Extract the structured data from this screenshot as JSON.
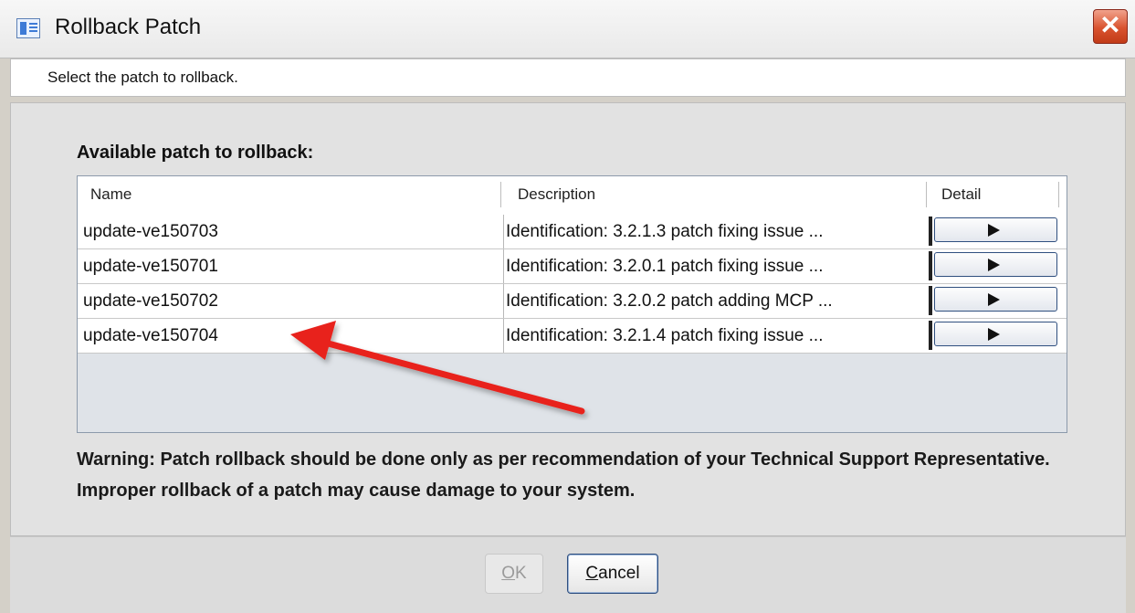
{
  "window": {
    "title": "Rollback Patch",
    "close_glyph": "✕"
  },
  "instruction": "Select the patch to rollback.",
  "list": {
    "label": "Available patch to rollback:",
    "columns": [
      "Name",
      "Description",
      "Detail"
    ],
    "rows": [
      {
        "name": "update-ve150703",
        "description": "Identification: 3.2.1.3 patch fixing issue ..."
      },
      {
        "name": "update-ve150701",
        "description": "Identification: 3.2.0.1 patch fixing issue ..."
      },
      {
        "name": "update-ve150702",
        "description": "Identification: 3.2.0.2 patch adding MCP ..."
      },
      {
        "name": "update-ve150704",
        "description": "Identification: 3.2.1.4 patch fixing issue ..."
      }
    ]
  },
  "warning": "Warning: Patch rollback should be done only as per recommendation of your Technical Support Representative. Improper rollback of a patch may cause damage to your system.",
  "buttons": {
    "ok_mnemonic": "O",
    "ok_rest": "K",
    "cancel_mnemonic": "C",
    "cancel_rest": "ancel"
  },
  "icons": {
    "title": "app-window-icon",
    "close": "close-icon",
    "detail": "play-arrow-icon",
    "annotation": "red-arrow-annotation"
  },
  "colors": {
    "close_button": "#d9532f",
    "annotation_arrow": "#e8231c",
    "disabled_text": "#9a9a9a"
  }
}
